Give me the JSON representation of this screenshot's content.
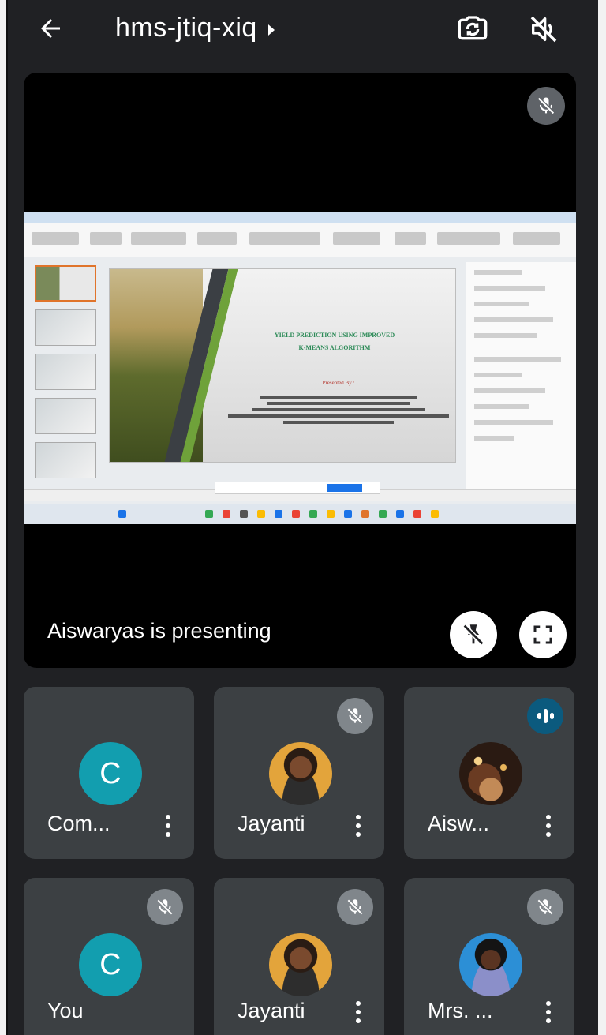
{
  "meeting": {
    "code": "hms-jtiq-xiq"
  },
  "presentation": {
    "label": "Aiswaryas is presenting",
    "slide": {
      "title_line1": "YIELD PREDICTION USING IMPROVED",
      "title_line2": "K-MEANS ALGORITHM",
      "presented_by": "Presented By :"
    }
  },
  "participants": [
    {
      "name": "Com...",
      "initial": "C",
      "avatar": "letter",
      "status": "none"
    },
    {
      "name": "Jayanti",
      "initial": "",
      "avatar": "photo",
      "status": "muted"
    },
    {
      "name": "Aisw...",
      "initial": "",
      "avatar": "photo",
      "status": "speaking"
    },
    {
      "name": "You",
      "initial": "C",
      "avatar": "letter",
      "status": "muted"
    },
    {
      "name": "Jayanti",
      "initial": "",
      "avatar": "photo",
      "status": "muted"
    },
    {
      "name": "Mrs. ...",
      "initial": "",
      "avatar": "photo",
      "status": "muted"
    }
  ],
  "colors": {
    "background": "#202124",
    "tile": "#3c4043",
    "avatar_teal": "#129eaf",
    "speaking_badge": "#0b5a7e",
    "mute_badge": "#80868b"
  },
  "icons": {
    "back": "arrow-left-icon",
    "switch_camera": "camera-switch-icon",
    "speaker_off": "speaker-off-icon",
    "mic_off": "mic-off-icon",
    "unpin": "unpin-icon",
    "fullscreen": "fullscreen-icon",
    "more": "more-vert-icon",
    "speaking": "audio-level-icon"
  }
}
